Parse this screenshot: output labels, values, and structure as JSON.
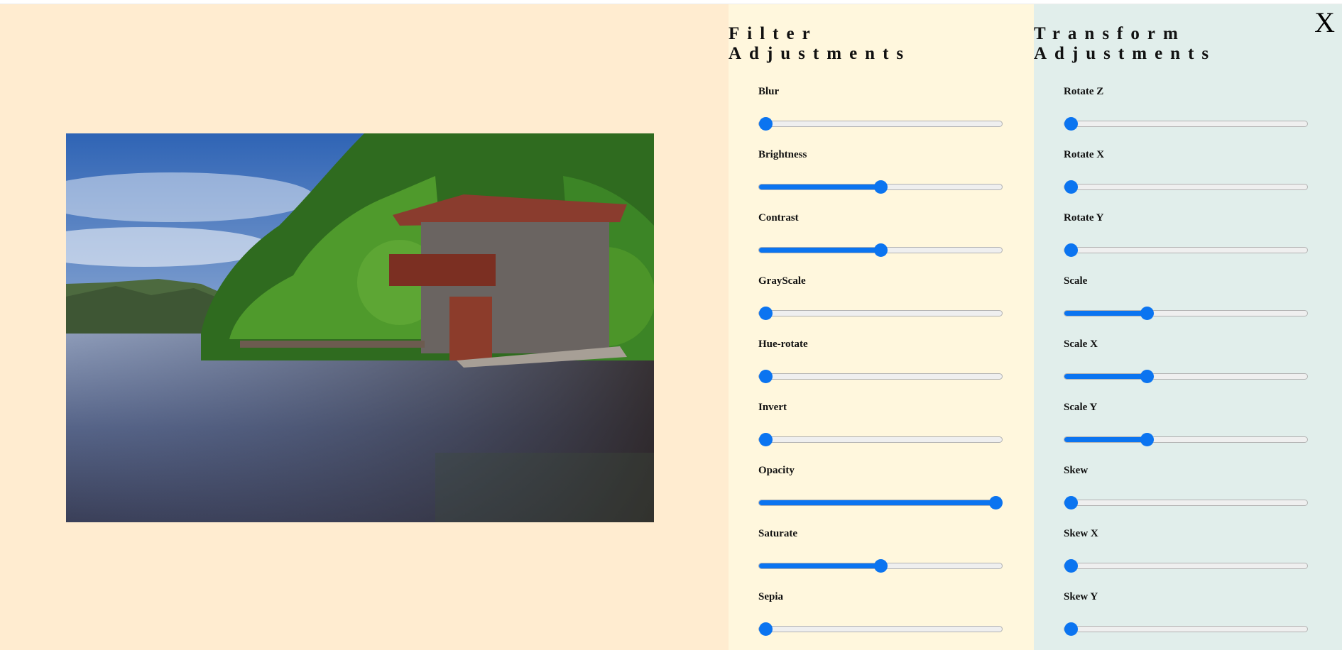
{
  "panels": {
    "filter": {
      "title": "Filter\nAdjustments",
      "controls": [
        {
          "label": "Blur",
          "value": 0
        },
        {
          "label": "Brightness",
          "value": 0.5
        },
        {
          "label": "Contrast",
          "value": 0.5
        },
        {
          "label": "GrayScale",
          "value": 0
        },
        {
          "label": "Hue-rotate",
          "value": 0
        },
        {
          "label": "Invert",
          "value": 0
        },
        {
          "label": "Opacity",
          "value": 1
        },
        {
          "label": "Saturate",
          "value": 0.5
        },
        {
          "label": "Sepia",
          "value": 0
        }
      ]
    },
    "transform": {
      "title": "Transform\nAdjustments",
      "controls": [
        {
          "label": "Rotate Z",
          "value": 0
        },
        {
          "label": "Rotate X",
          "value": 0
        },
        {
          "label": "Rotate Y",
          "value": 0
        },
        {
          "label": "Scale",
          "value": 0.33
        },
        {
          "label": "Scale X",
          "value": 0.33
        },
        {
          "label": "Scale Y",
          "value": 0.33
        },
        {
          "label": "Skew",
          "value": 0
        },
        {
          "label": "Skew X",
          "value": 0
        },
        {
          "label": "Skew Y",
          "value": 0
        }
      ]
    }
  },
  "close_label": "X",
  "colors": {
    "accent": "#0b74f0",
    "preview_bg": "#ffecd0",
    "filter_bg": "#fff7dd",
    "transform_bg": "#e1eeeb"
  }
}
